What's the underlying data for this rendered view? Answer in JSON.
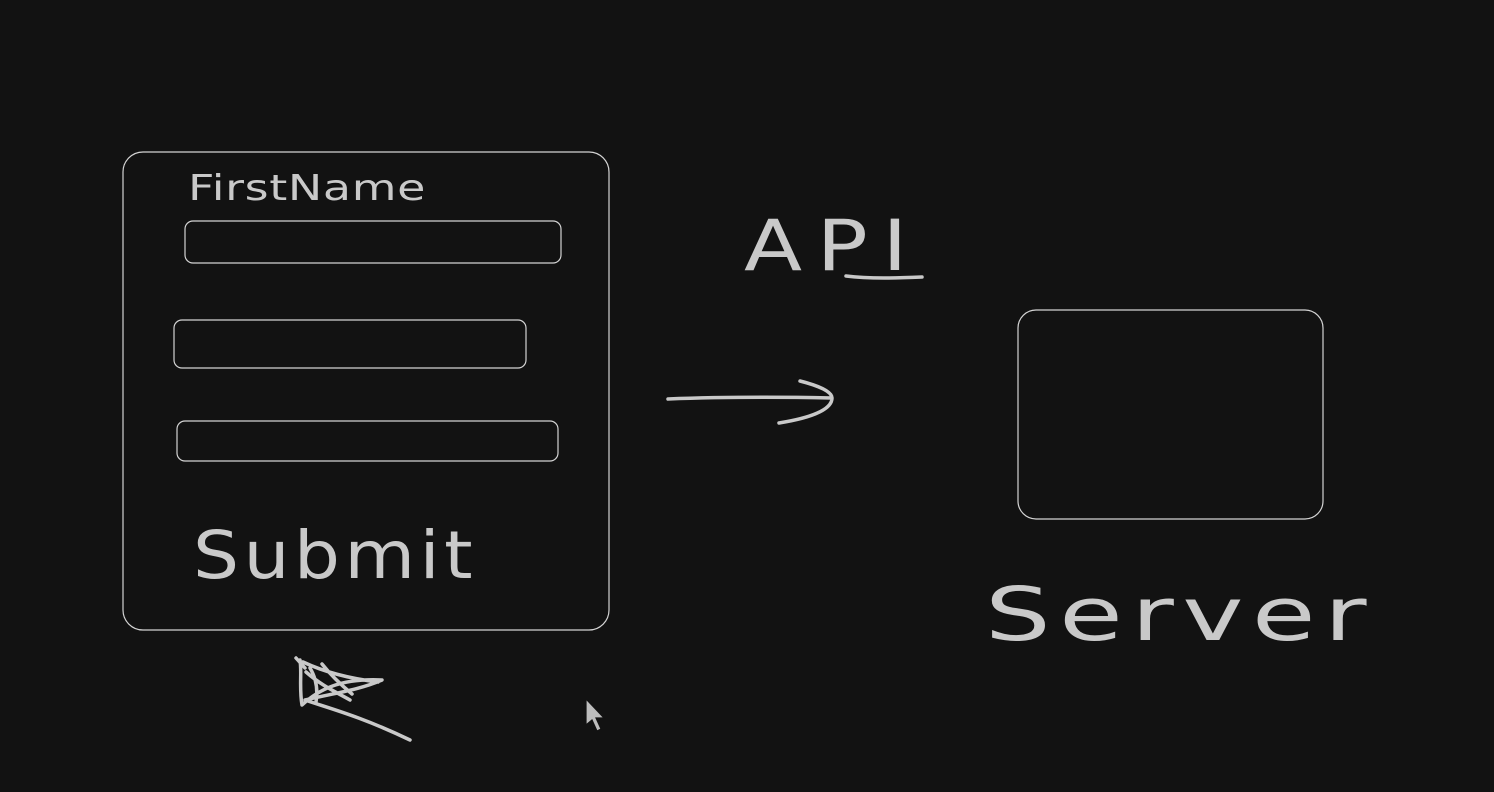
{
  "colors": {
    "background": "#121212",
    "stroke": "#d4d4d4",
    "ink": "#c9c9c9"
  },
  "form": {
    "label": "FirstName",
    "submit_label": "Submit"
  },
  "api": {
    "label": "API"
  },
  "server": {
    "label": "Server"
  },
  "icons": {
    "pointer": "mouse-pointer-icon",
    "scribble": "pen-scribble-icon",
    "arrow": "arrow-right-icon"
  }
}
